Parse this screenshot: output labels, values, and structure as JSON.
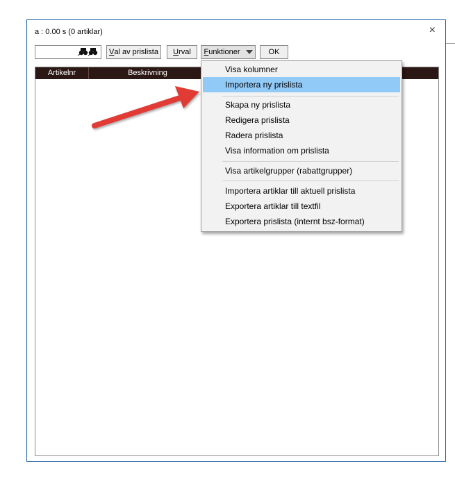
{
  "window": {
    "title": "a : 0.00 s (0 artiklar)",
    "close_glyph": "×"
  },
  "toolbar": {
    "search_value": "",
    "binoculars_glyph": "🔍🔍",
    "val_av_prislista_label_ul": "V",
    "val_av_prislista_label_rest": "al av prislista",
    "urval_label_ul": "U",
    "urval_label_rest": "rval",
    "funktioner_label_ul": "F",
    "funktioner_label_rest": "unktioner",
    "ok_label": "OK"
  },
  "table": {
    "columns": [
      "Artikelnr",
      "Beskrivning"
    ]
  },
  "menu": {
    "items": [
      "Visa kolumner",
      "Importera ny prislista",
      "Skapa ny prislista",
      "Redigera prislista",
      "Radera prislista",
      "Visa information om prislista",
      "Visa artikelgrupper (rabattgrupper)",
      "Importera artiklar till aktuell prislista",
      "Exportera artiklar till textfil",
      "Exportera prislista (internt bsz-format)"
    ],
    "highlighted_index": 1
  },
  "colors": {
    "highlight": "#91c9f7",
    "header_bg": "#2b1713",
    "annotation_arrow": "#e03a35"
  }
}
